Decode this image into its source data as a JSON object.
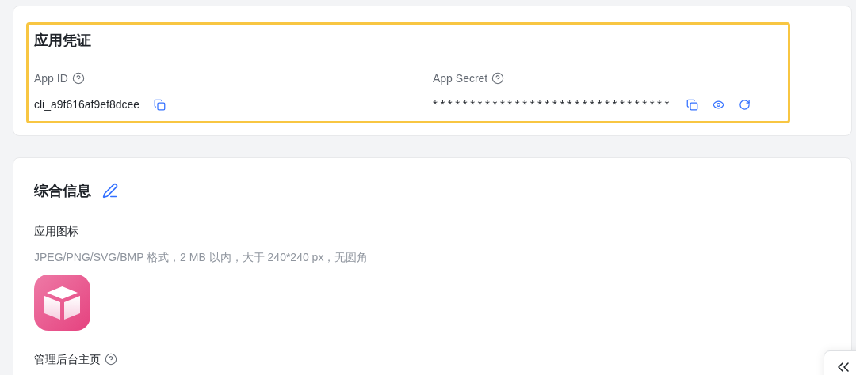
{
  "credentials": {
    "title": "应用凭证",
    "fields": [
      {
        "kind": "plain",
        "label": "App ID",
        "value": "cli_a9f616af9ef8dcee",
        "actions": [
          {
            "kind": "copy"
          }
        ]
      },
      {
        "kind": "masked",
        "label": "App Secret",
        "value": "********************************",
        "actions": [
          {
            "kind": "copy"
          },
          {
            "kind": "view"
          },
          {
            "kind": "refresh"
          }
        ]
      }
    ]
  },
  "info": {
    "title": "综合信息",
    "icon_section": {
      "label": "应用图标",
      "hint": "JPEG/PNG/SVG/BMP 格式，2 MB 以内，大于 240*240 px，无圆角"
    },
    "homepage_label": "管理后台主页"
  }
}
